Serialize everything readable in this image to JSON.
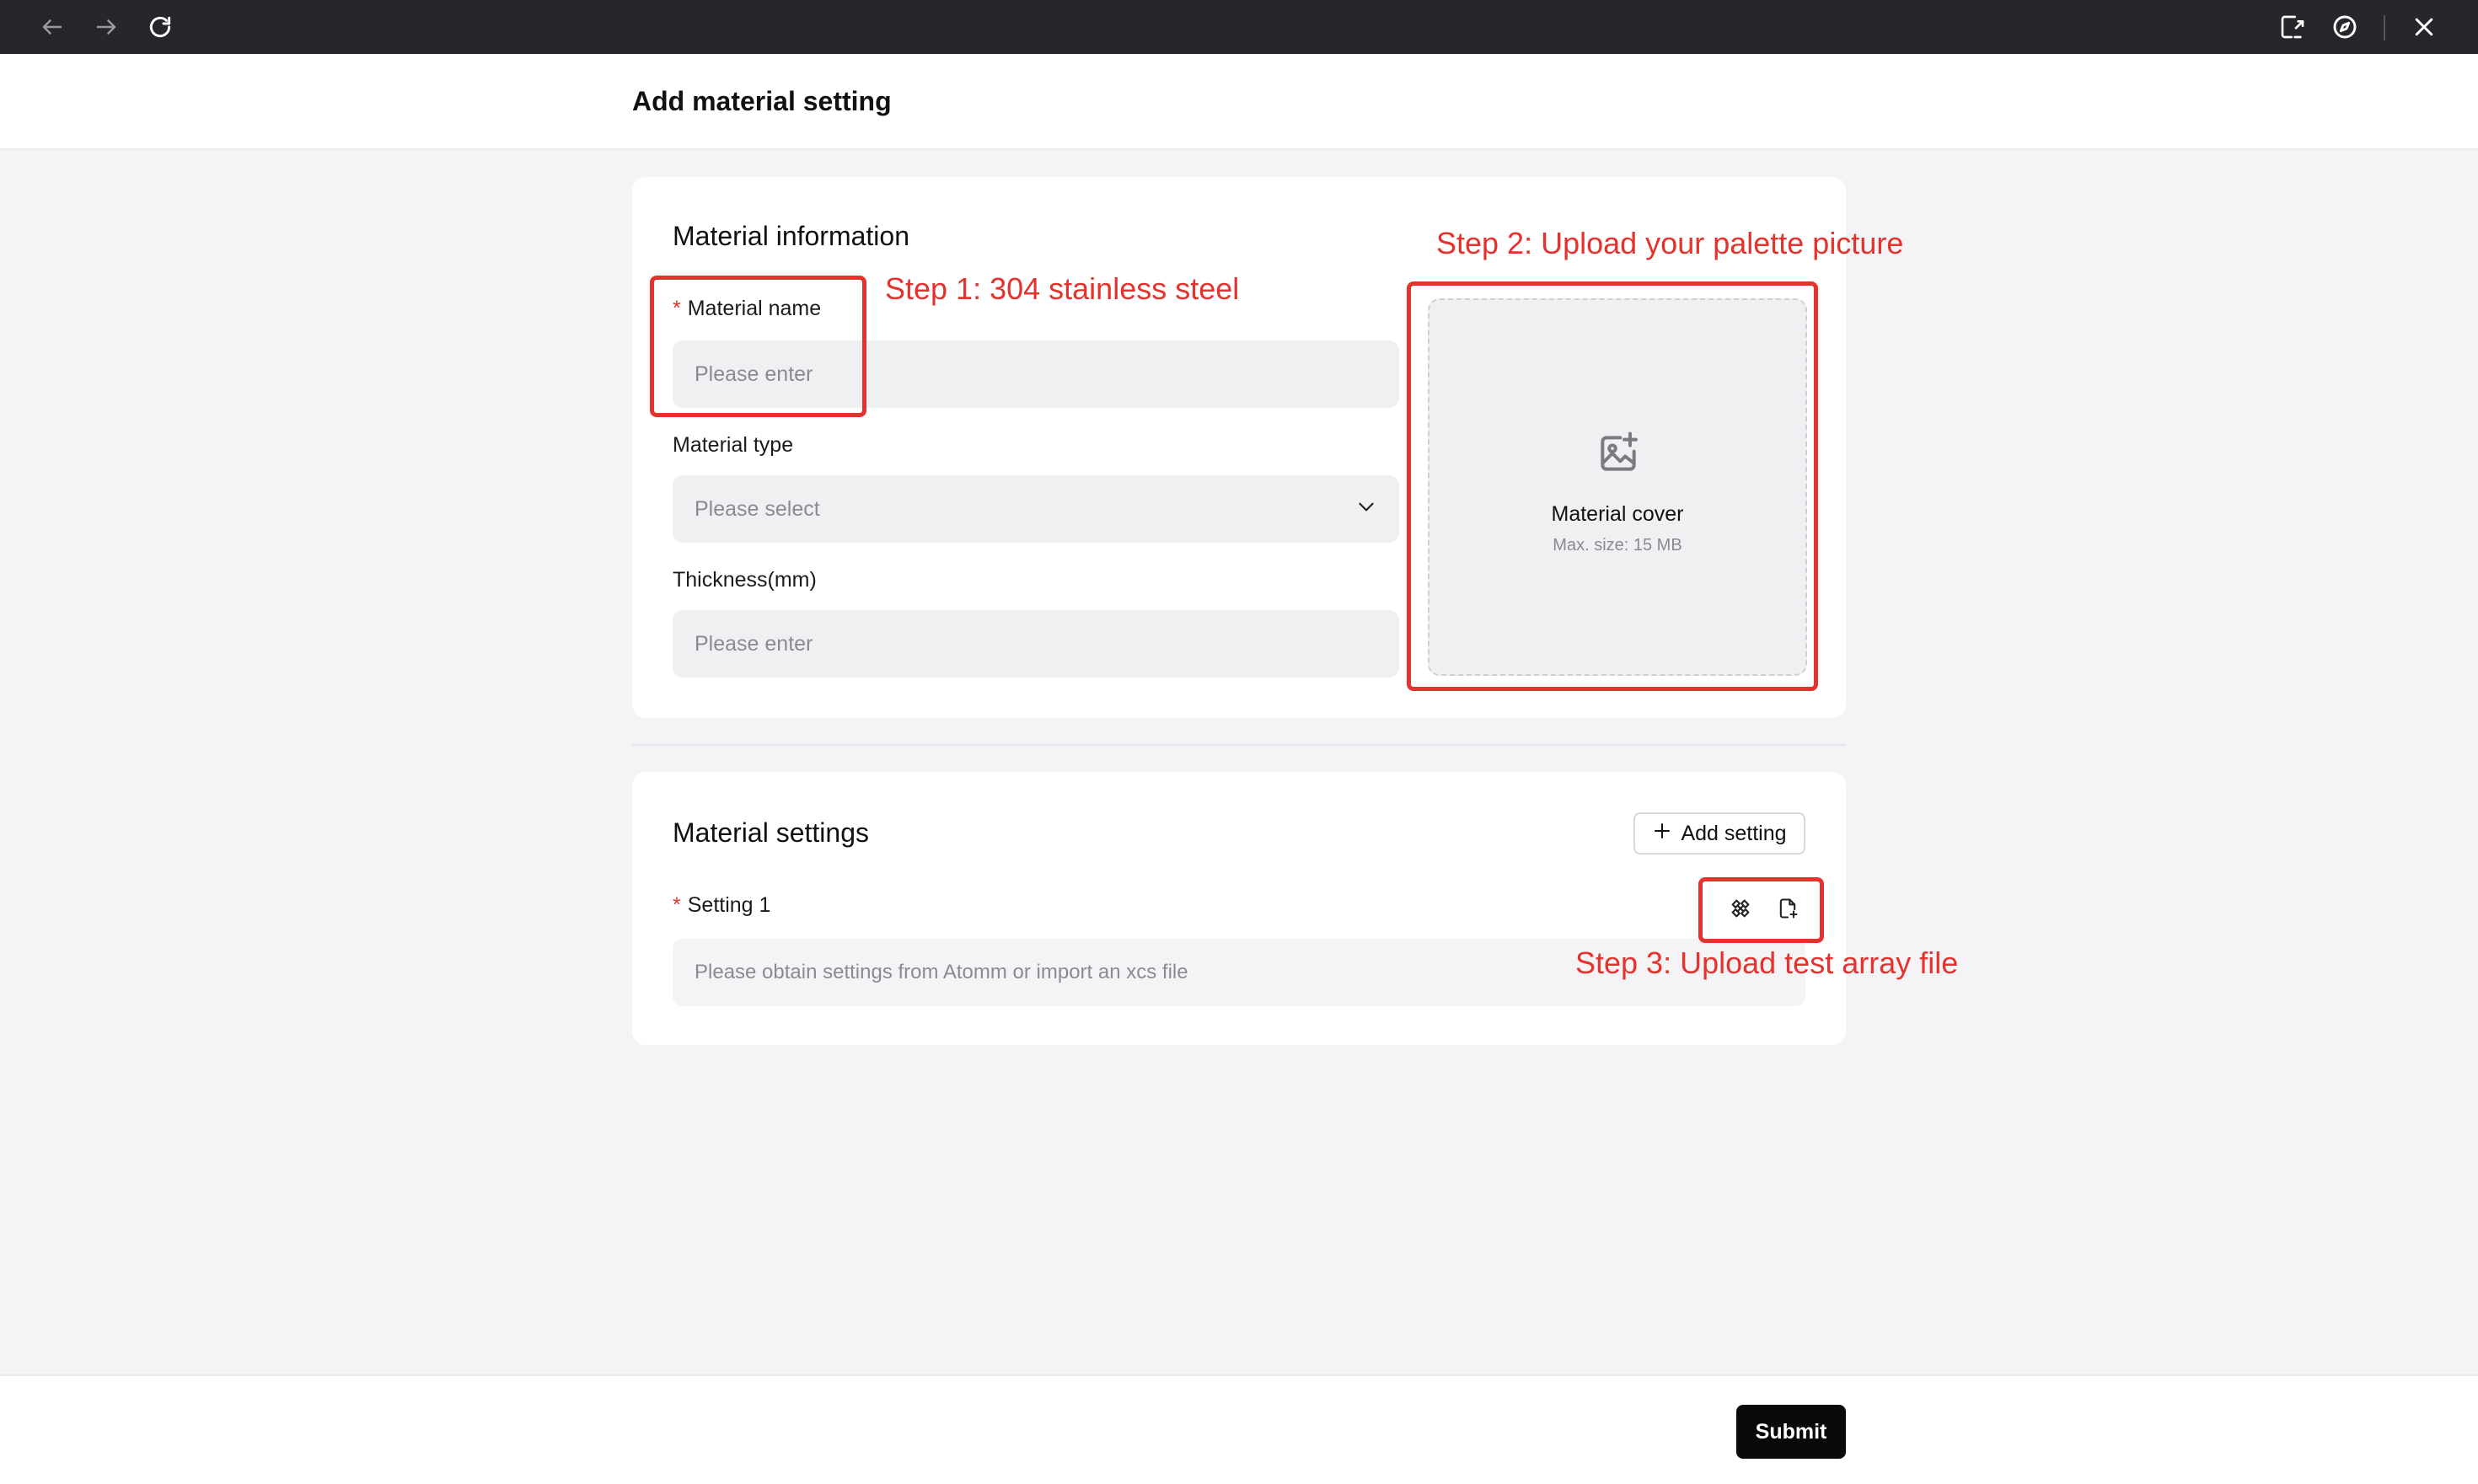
{
  "browser": {
    "icons": [
      "back-arrow-icon",
      "forward-arrow-icon",
      "reload-icon",
      "external-link-icon",
      "compass-icon",
      "close-icon"
    ]
  },
  "header": {
    "title": "Add material setting"
  },
  "material_info": {
    "title": "Material information",
    "name_label": "Material name",
    "name_placeholder": "Please enter",
    "type_label": "Material type",
    "type_placeholder": "Please select",
    "thickness_label": "Thickness(mm)",
    "thickness_placeholder": "Please enter",
    "cover_title": "Material cover",
    "cover_hint": "Max. size: 15 MB"
  },
  "material_settings": {
    "title": "Material settings",
    "add_label": "Add setting",
    "setting_label": "Setting 1",
    "setting_placeholder": "Please obtain settings from Atomm or import an xcs file"
  },
  "annotations": {
    "step1": "Step 1: 304 stainless steel",
    "step2": "Step 2: Upload your palette picture",
    "step3": "Step 3: Upload test array file"
  },
  "footer": {
    "submit_label": "Submit"
  },
  "colors": {
    "annotation": "#e5322d",
    "primary_button": "#0a0a0a",
    "topbar": "#26272b"
  }
}
